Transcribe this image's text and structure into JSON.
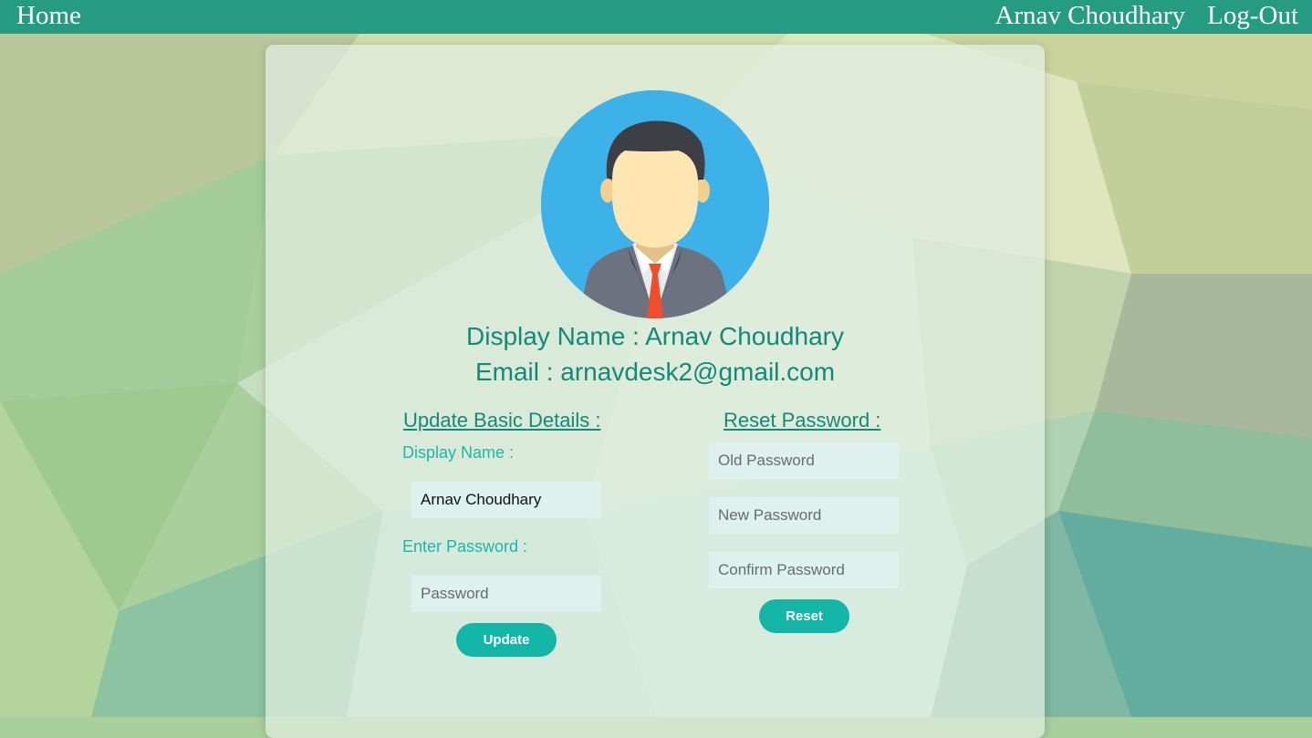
{
  "navbar": {
    "home_label": "Home",
    "user_name": "Arnav Choudhary",
    "logout_label": "Log-Out"
  },
  "profile": {
    "display_name_line": "Display Name : Arnav Choudhary",
    "email_line": "Email : arnavdesk2@gmail.com",
    "avatar_icon": "user-avatar-icon"
  },
  "update_section": {
    "title": "Update Basic Details :",
    "display_name_label": "Display Name :",
    "display_name_value": "Arnav Choudhary",
    "password_label": "Enter Password :",
    "password_placeholder": "Password",
    "button_label": "Update"
  },
  "reset_section": {
    "title": "Reset Password :",
    "old_placeholder": "Old Password",
    "new_placeholder": "New Password",
    "confirm_placeholder": "Confirm Password",
    "button_label": "Reset"
  },
  "colors": {
    "navbar": "#259b82",
    "accent_text": "#13897a",
    "label_text": "#1bb7a8",
    "button": "#13b5a6",
    "input_bg": "#ddf1ee"
  }
}
